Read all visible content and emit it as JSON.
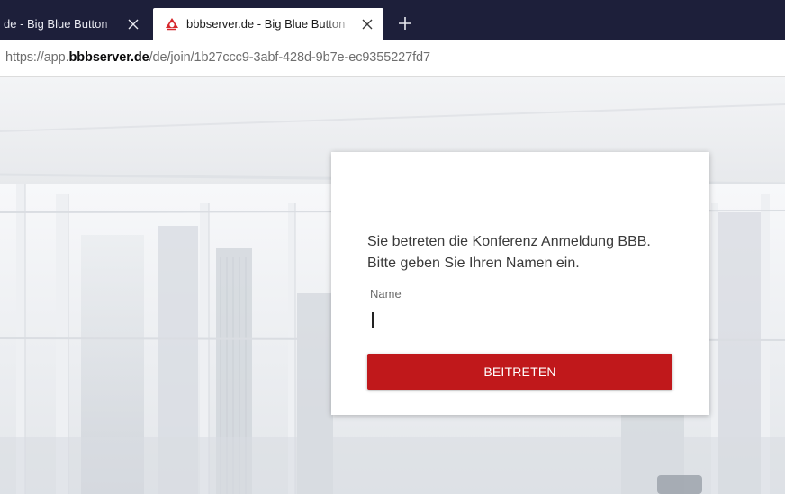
{
  "browser": {
    "tabs": [
      {
        "title": "de - Big Blue Button",
        "active": false,
        "close_icon": "close-icon"
      },
      {
        "title": "bbbserver.de - Big Blue Button",
        "active": true,
        "favicon": "bbbserver-logo-icon",
        "close_icon": "close-icon"
      }
    ],
    "new_tab_icon": "plus-icon",
    "url": {
      "prefix": "https://app.",
      "host": "bbbserver.de",
      "path": "/de/join/1b27ccc9-3abf-428d-9b7e-ec9355227fd7"
    }
  },
  "card": {
    "line1": "Sie betreten die Konferenz Anmeldung BBB.",
    "line2": "Bitte geben Sie Ihren Namen ein.",
    "name_label": "Name",
    "name_value": "",
    "button_label": "BEITRETEN"
  },
  "colors": {
    "tabbar_bg": "#1d1f3a",
    "accent_red": "#c0181b",
    "favicon_red": "#d6262b"
  }
}
